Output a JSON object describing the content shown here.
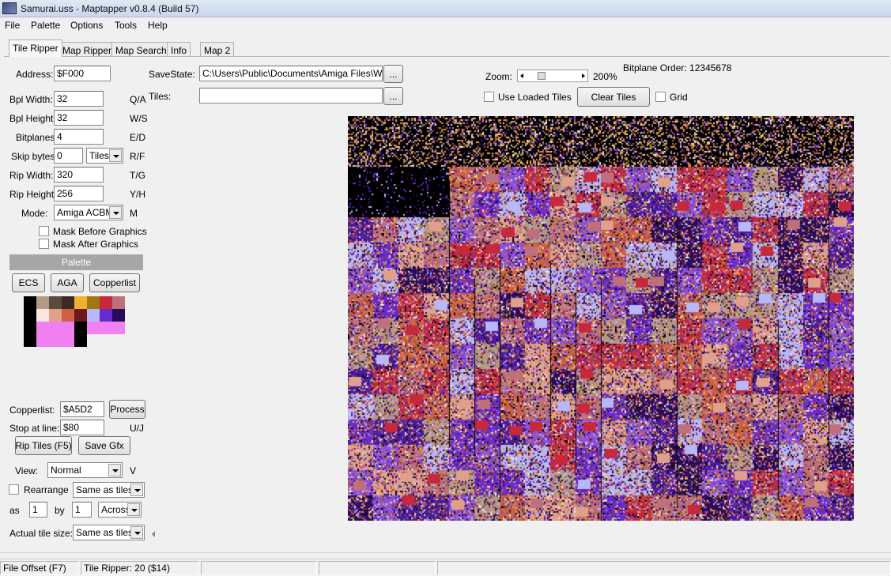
{
  "window": {
    "title": "Samurai.uss - Maptapper v0.8.4 (Build 57)"
  },
  "menu": [
    "File",
    "Palette",
    "Options",
    "Tools",
    "Help"
  ],
  "tabs": [
    {
      "label": "Tile Ripper",
      "active": true
    },
    {
      "label": "Map Ripper"
    },
    {
      "label": "Map Search"
    },
    {
      "label": "Info"
    },
    {
      "label": "Map 2"
    }
  ],
  "form": {
    "address_label": "Address:",
    "address_value": "$F000",
    "bpl_width_label": "Bpl Width:",
    "bpl_width_value": "32",
    "bpl_width_key": "Q/A",
    "bpl_height_label": "Bpl Height:",
    "bpl_height_value": "32",
    "bpl_height_key": "W/S",
    "bitplanes_label": "Bitplanes:",
    "bitplanes_value": "4",
    "bitplanes_key": "E/D",
    "skip_label": "Skip bytes:",
    "skip_value": "0",
    "skip_unit": "Tiles",
    "skip_key": "R/F",
    "rip_width_label": "Rip Width:",
    "rip_width_value": "320",
    "rip_width_key": "T/G",
    "rip_height_label": "Rip Height:",
    "rip_height_value": "256",
    "rip_height_key": "Y/H",
    "mode_label": "Mode:",
    "mode_value": "Amiga ACBM",
    "mode_key": "M",
    "mask_before": "Mask Before Graphics",
    "mask_after": "Mask After Graphics"
  },
  "palette": {
    "header": "Palette",
    "buttons": [
      "ECS",
      "AGA",
      "Copperlist"
    ],
    "colors": [
      [
        "#000000",
        "#b39a85",
        "#5a4a3c",
        "#3a2a22",
        "#f0b030",
        "#a07810",
        "#c8283c",
        "#c0707a"
      ],
      [
        "#000000",
        "#f8e8e0",
        "#e0a08c",
        "#d06040",
        "#6a1a1a",
        "#b8b8f8",
        "#6a2ad0",
        "#2a0a5a"
      ],
      [
        "#000000",
        "#f080f0",
        "#f080f0",
        "#f080f0",
        "#000000",
        "#f080f0",
        "#f080f0",
        "#f080f0"
      ],
      [
        "#000000",
        "#f080f0",
        "#f080f0",
        "#f080f0",
        "#000000",
        null,
        null,
        null
      ]
    ]
  },
  "copper": {
    "copperlist_label": "Copperlist:",
    "copperlist_value": "$A5D2",
    "process_button": "Process",
    "stop_label": "Stop at line::",
    "stop_value": "$80",
    "stop_key": "U/J"
  },
  "actions": {
    "rip_tiles": "Rip Tiles (F5)",
    "save_gfx": "Save Gfx"
  },
  "view": {
    "view_label": "View:",
    "view_value": "Normal",
    "view_key": "V",
    "rearrange_label": "Rearrange",
    "rearrange_value": "Same as tiles",
    "as_label": "as",
    "as_value": "1",
    "by_label": "by",
    "by_value": "1",
    "direction_value": "Across",
    "actual_label": "Actual tile size:",
    "actual_value": "Same as tiles"
  },
  "savestate": {
    "label": "SaveState:",
    "path": "C:\\Users\\Public\\Documents\\Amiga Files\\WinUAE",
    "browse": "...",
    "tiles_label": "Tiles:",
    "tiles_value": "",
    "tiles_browse": "..."
  },
  "zoom": {
    "label": "Zoom:",
    "value": "200%",
    "slider_fraction": 0.2,
    "bitplane_order_label": "Bitplane Order: 12345678",
    "use_loaded_tiles": "Use Loaded Tiles",
    "clear_tiles": "Clear Tiles",
    "grid": "Grid"
  },
  "status": {
    "file_offset": "File Offset (F7)",
    "tile_ripper": "Tile Ripper: 20 ($14)",
    "p3": "",
    "p4": "",
    "p5": ""
  },
  "colors": {
    "canvas_palette": [
      "#000000",
      "#1a0a3a",
      "#2a0a5a",
      "#4a1aa0",
      "#6a2ad0",
      "#8a50e0",
      "#b8b8f8",
      "#e0a08c",
      "#d06040",
      "#c0707a",
      "#c8283c",
      "#f8e8e0",
      "#b39a85",
      "#a07810",
      "#f0b030",
      "#5a4a3c"
    ]
  }
}
